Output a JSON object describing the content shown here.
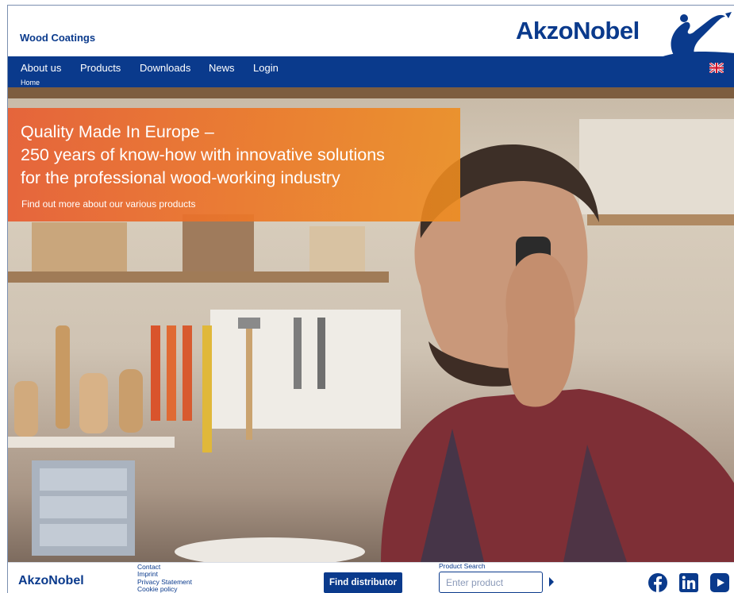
{
  "header": {
    "site_name": "Wood Coatings",
    "brand": "AkzoNobel"
  },
  "nav": {
    "items": [
      {
        "label": "About us"
      },
      {
        "label": "Products"
      },
      {
        "label": "Downloads"
      },
      {
        "label": "News"
      },
      {
        "label": "Login"
      }
    ],
    "language_icon": "uk-flag-icon"
  },
  "breadcrumb": {
    "home": "Home"
  },
  "hero": {
    "title_line1": "Quality Made In Europe –",
    "title_line2": "250 years of know-how with innovative solutions",
    "title_line3": "for the professional wood-working industry",
    "link": "Find out more about our various products"
  },
  "footer": {
    "brand": "AkzoNobel",
    "links": [
      {
        "label": "Contact"
      },
      {
        "label": "Imprint"
      },
      {
        "label": "Privacy Statement"
      },
      {
        "label": "Cookie policy"
      }
    ],
    "find_distributor": "Find distributor",
    "product_search_label": "Product Search",
    "product_search_placeholder": "Enter product",
    "social_icons": [
      "facebook-icon",
      "linkedin-icon",
      "youtube-icon"
    ]
  },
  "colors": {
    "brand_blue": "#0a3a8c",
    "hero_overlay": "#e8702e"
  }
}
